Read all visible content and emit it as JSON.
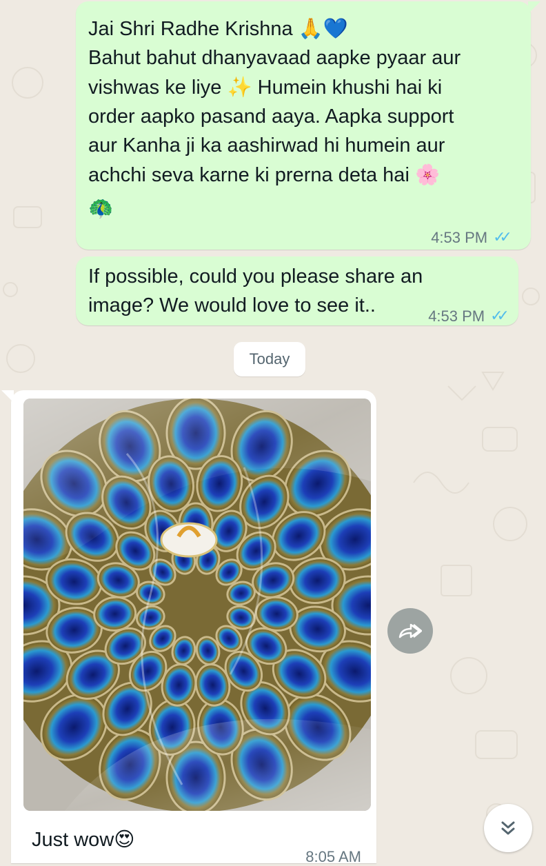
{
  "messages": [
    {
      "lines": [
        {
          "text": "Jai Shri Radhe Krishna ",
          "emoji": "🙏💙"
        },
        {
          "text": "Bahut bahut dhanyavaad aapke pyaar aur",
          "emoji": ""
        },
        {
          "text": "vishwas ke liye ",
          "emoji": "✨",
          "after": " Humein khushi hai ki"
        },
        {
          "text": "order aapko pasand aaya. Aapka support",
          "emoji": ""
        },
        {
          "text": "aur Kanha ji ka aashirwad hi humein aur",
          "emoji": ""
        },
        {
          "text": "achchi seva karne ki prerna deta hai ",
          "emoji": "🌸"
        },
        {
          "text": "",
          "emoji": "🦚"
        }
      ],
      "time": "4:53 PM",
      "status_icon": "double-check-read-icon"
    },
    {
      "lines": [
        {
          "text": "If possible, could you please share an"
        },
        {
          "text": "image? We would love to see it.."
        }
      ],
      "time": "4:53 PM",
      "status_icon": "double-check-read-icon"
    }
  ],
  "date_chip": "Today",
  "incoming": {
    "image_alt": "peacock-feather-mandala-photo",
    "caption": "Just wow",
    "caption_emoji": "😍",
    "time": "8:05 AM"
  },
  "colors": {
    "outgoing_bubble": "#d9fdd3",
    "incoming_bubble": "#ffffff",
    "read_ticks": "#53bdeb",
    "background": "#efeae2"
  }
}
